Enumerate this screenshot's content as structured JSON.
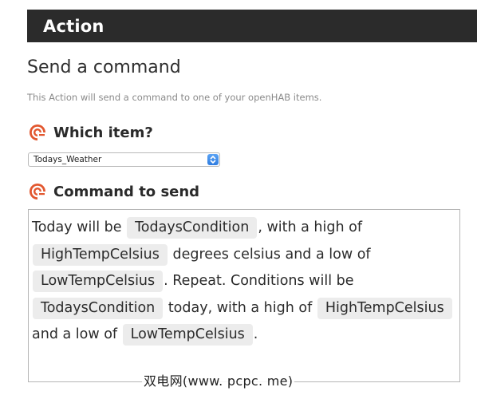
{
  "header": {
    "title": "Action"
  },
  "section": {
    "title": "Send a command",
    "description": "This Action will send a command to one of your openHAB items."
  },
  "fields": {
    "item": {
      "label": "Which item?",
      "icon": "ifttt-field-icon",
      "selected_value": "Todays_Weather"
    },
    "command": {
      "label": "Command to send",
      "icon": "ifttt-field-icon",
      "segments": [
        {
          "type": "text",
          "value": "Today will be "
        },
        {
          "type": "ingredient",
          "value": "TodaysCondition"
        },
        {
          "type": "text",
          "value": ", with a high of "
        },
        {
          "type": "ingredient",
          "value": "HighTempCelsius"
        },
        {
          "type": "text",
          "value": " degrees celsius and a low of "
        },
        {
          "type": "ingredient",
          "value": "LowTempCelsius"
        },
        {
          "type": "text",
          "value": ". Repeat. Conditions will be "
        },
        {
          "type": "ingredient",
          "value": "TodaysCondition"
        },
        {
          "type": "text",
          "value": " today, with a high of "
        },
        {
          "type": "ingredient",
          "value": "HighTempCelsius"
        },
        {
          "type": "text",
          "value": " and a low of "
        },
        {
          "type": "ingredient",
          "value": "LowTempCelsius"
        },
        {
          "type": "text",
          "value": "."
        }
      ]
    }
  },
  "watermark": "双电网(www. pcpc. me)",
  "colors": {
    "header_bg": "#2b2b2b",
    "icon_accent": "#e2572f",
    "select_arrow": "#3b8ced",
    "pill_bg": "#ececec"
  }
}
